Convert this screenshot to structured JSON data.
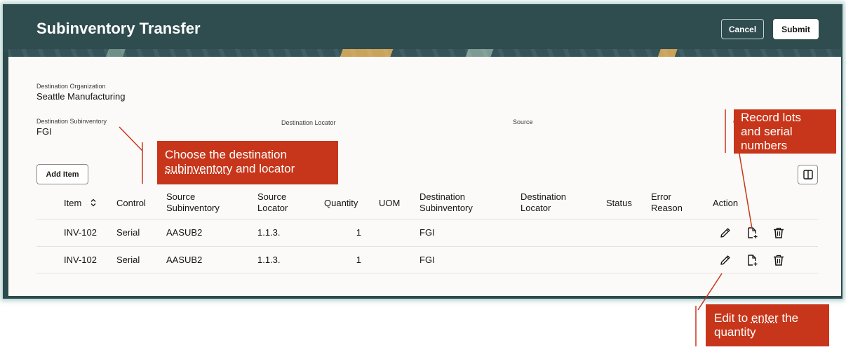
{
  "header": {
    "title": "Subinventory Transfer",
    "cancel_label": "Cancel",
    "submit_label": "Submit"
  },
  "form": {
    "destination_organization": {
      "label": "Destination Organization",
      "value": "Seattle Manufacturing"
    },
    "destination_subinventory": {
      "label": "Destination Subinventory",
      "value": "FGI"
    },
    "destination_locator": {
      "label": "Destination Locator",
      "value": ""
    },
    "source": {
      "label": "Source",
      "value": ""
    }
  },
  "toolbar": {
    "add_item_label": "Add Item"
  },
  "table": {
    "columns": {
      "item": "Item",
      "control": "Control",
      "source_subinventory": "Source Subinventory",
      "source_locator": "Source Locator",
      "quantity": "Quantity",
      "uom": "UOM",
      "destination_subinventory": "Destination Subinventory",
      "destination_locator": "Destination Locator",
      "status": "Status",
      "error_reason": "Error Reason",
      "action": "Action"
    },
    "rows": [
      {
        "item": "INV-102",
        "control": "Serial",
        "source_subinventory": "AASUB2",
        "source_locator": "1.1.3.",
        "quantity": "1",
        "uom": "",
        "destination_subinventory": "FGI",
        "destination_locator": "",
        "status": "",
        "error_reason": ""
      },
      {
        "item": "INV-102",
        "control": "Serial",
        "source_subinventory": "AASUB2",
        "source_locator": "1.1.3.",
        "quantity": "1",
        "uom": "",
        "destination_subinventory": "FGI",
        "destination_locator": "",
        "status": "",
        "error_reason": ""
      }
    ]
  },
  "callouts": {
    "destination": {
      "line1": "Choose the destination",
      "line2_u": "subinventory",
      "line2_rest": " and locator"
    },
    "lots": {
      "line1": "Record lots",
      "line2": "and serial",
      "line3": "numbers"
    },
    "edit": {
      "line1_a": "Edit to ",
      "line1_u": "enter",
      "line1_b": " the",
      "line2": "quantity"
    }
  },
  "colors": {
    "header_bg": "#2f4c4f",
    "callout_bg": "#c7361a",
    "panel_bg": "#fbfaf8"
  },
  "icons": [
    "sort-icon",
    "columns-icon",
    "edit-icon",
    "document-add-icon",
    "delete-icon"
  ]
}
